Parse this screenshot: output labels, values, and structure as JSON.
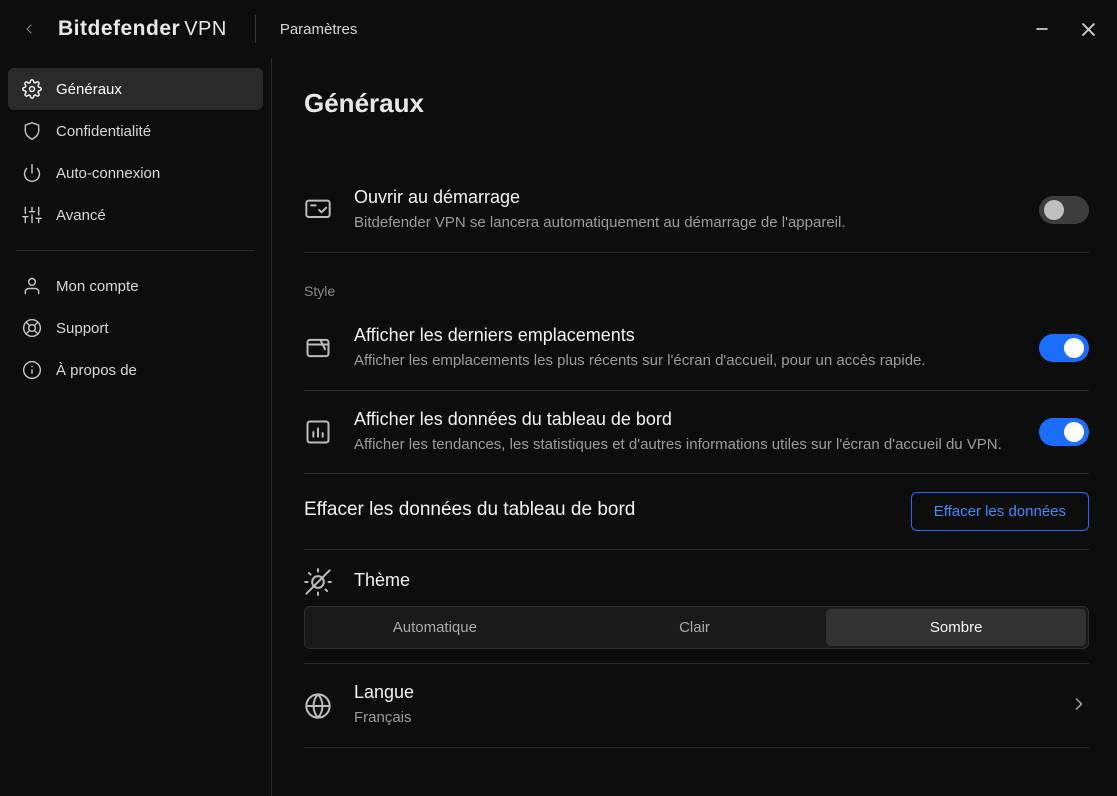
{
  "header": {
    "brand_main": "Bitdefender",
    "brand_sub": "VPN",
    "crumb": "Paramètres"
  },
  "sidebar": {
    "items": [
      {
        "label": "Généraux"
      },
      {
        "label": "Confidentialité"
      },
      {
        "label": "Auto-connexion"
      },
      {
        "label": "Avancé"
      }
    ],
    "items2": [
      {
        "label": "Mon compte"
      },
      {
        "label": "Support"
      },
      {
        "label": "À propos de"
      }
    ]
  },
  "main": {
    "title": "Généraux",
    "startup": {
      "title": "Ouvrir au démarrage",
      "desc": "Bitdefender VPN se lancera automatiquement au démarrage de l'appareil.",
      "on": false
    },
    "style_label": "Style",
    "recent": {
      "title": "Afficher les derniers emplacements",
      "desc": "Afficher les emplacements les plus récents sur l'écran d'accueil, pour un accès rapide.",
      "on": true
    },
    "dashboard": {
      "title": "Afficher les données du tableau de bord",
      "desc": "Afficher les tendances, les statistiques et d'autres informations utiles sur l'écran d'accueil du VPN.",
      "on": true
    },
    "erase": {
      "title": "Effacer les données du tableau de bord",
      "button": "Effacer les données"
    },
    "theme": {
      "title": "Thème",
      "options": [
        "Automatique",
        "Clair",
        "Sombre"
      ],
      "selected": 2
    },
    "language": {
      "title": "Langue",
      "value": "Français"
    }
  }
}
